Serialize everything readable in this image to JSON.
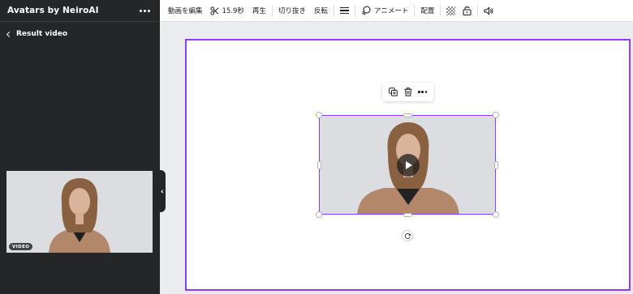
{
  "sidebar": {
    "title": "Avatars by NeiroAI",
    "back_label": "Result video",
    "thumbnail_badge": "VIDEO"
  },
  "toolbar": {
    "edit_video": "動画を編集",
    "duration": "15.9秒",
    "play": "再生",
    "crop": "切り抜き",
    "flip": "反転",
    "animate": "アニメート",
    "position": "配置"
  },
  "colors": {
    "accent": "#8b3dff",
    "sidebar_bg": "#252627",
    "canvas_bg": "#ebecf0"
  },
  "icons": [
    "more-icon",
    "chevron-left-icon",
    "scissors-icon",
    "line-style-icon",
    "animate-icon",
    "transparency-icon",
    "lock-icon",
    "volume-icon",
    "duplicate-icon",
    "trash-icon",
    "play-icon",
    "rotate-icon"
  ]
}
